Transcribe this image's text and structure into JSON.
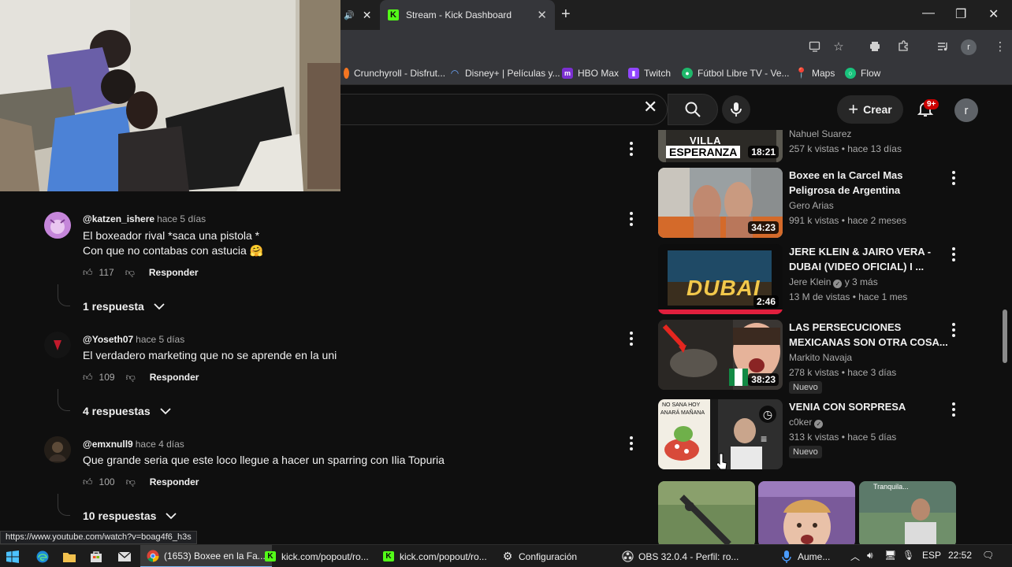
{
  "browser": {
    "active_tab_title": "Stream - Kick Dashboard",
    "profile_letter": "r",
    "bookmarks": [
      {
        "label": "Crunchyroll - Disfrut...",
        "color": "#f47521"
      },
      {
        "label": "Disney+ | Películas y...",
        "color": "#1a3a8a"
      },
      {
        "label": "HBO Max",
        "color": "#7b2fd1"
      },
      {
        "label": "Twitch",
        "color": "#9146ff"
      },
      {
        "label": "Fútbol Libre TV - Ve...",
        "color": "#1fb86b"
      },
      {
        "label": "Maps",
        "color": "#34a853"
      },
      {
        "label": "Flow",
        "color": "#19c37d"
      }
    ],
    "status_url": "https://www.youtube.com/watch?v=boag4f6_h3s"
  },
  "youtube": {
    "create_label": "Crear",
    "notifications": "9+",
    "avatar_letter": "r"
  },
  "comments": [
    {
      "author": "@katzen_ishere",
      "time": "hace 5 días",
      "lines": [
        "El boxeador rival *saca una pistola *",
        "Con que no contabas con astucia 🤗"
      ],
      "likes": "117",
      "reply_label": "Responder",
      "replies": "1 respuesta"
    },
    {
      "author": "@Yoseth07",
      "time": "hace 5 días",
      "lines": [
        "El verdadero marketing que no se aprende en la uni"
      ],
      "likes": "109",
      "reply_label": "Responder",
      "replies": "4 respuestas"
    },
    {
      "author": "@emxnull9",
      "time": "hace 4 días",
      "lines": [
        "Que grande seria que este loco llegue a hacer un sparring con Ilia Topuria"
      ],
      "likes": "100",
      "reply_label": "Responder",
      "replies": "10 respuestas"
    }
  ],
  "related": [
    {
      "title": "",
      "thumb_text": [
        "VILLA",
        "ESPERANZA"
      ],
      "duration": "18:21",
      "channel": "Nahuel Suarez",
      "meta": "257 k vistas • hace 13 días"
    },
    {
      "title": "Boxee en la Carcel Mas Peligrosa de Argentina",
      "duration": "34:23",
      "channel": "Gero Arias",
      "meta": "991 k vistas • hace 2 meses"
    },
    {
      "title": "JERE KLEIN & JAIRO VERA - DUBAI (VIDEO OFICIAL) I ...",
      "thumb_text": [
        "DUBAI"
      ],
      "duration": "2:46",
      "channel": "Jere Klein",
      "channel_extra": "y 3 más",
      "meta": "13 M de vistas • hace 1 mes"
    },
    {
      "title": "LAS PERSECUCIONES MEXICANAS SON OTRA COSA...",
      "duration": "38:23",
      "channel": "Markito Navaja",
      "meta": "278 k vistas • hace 3 días",
      "badge": "Nuevo"
    },
    {
      "title": "VENIA CON SORPRESA",
      "thumb_text": [
        "NO SANA HOY",
        "ANARÁ MAÑANA"
      ],
      "channel": "c0ker",
      "meta": "313 k vistas • hace 5 días",
      "badge": "Nuevo"
    }
  ],
  "shorts": [
    {
      "label": ""
    },
    {
      "label": ""
    },
    {
      "label": "Tranquila..."
    }
  ],
  "taskbar": {
    "apps": [
      {
        "label": "(1653) Boxee en la Fa..."
      },
      {
        "label": "kick.com/popout/ro..."
      },
      {
        "label": "kick.com/popout/ro..."
      },
      {
        "label": "Configuración"
      },
      {
        "label": "OBS 32.0.4 - Perfil: ro..."
      },
      {
        "label": "Aume..."
      }
    ],
    "lang": "ESP",
    "time": "22:52"
  },
  "colors": {
    "kick_green": "#53fc18",
    "yt_red": "#cc0000",
    "bg": "#0f0f0f"
  }
}
